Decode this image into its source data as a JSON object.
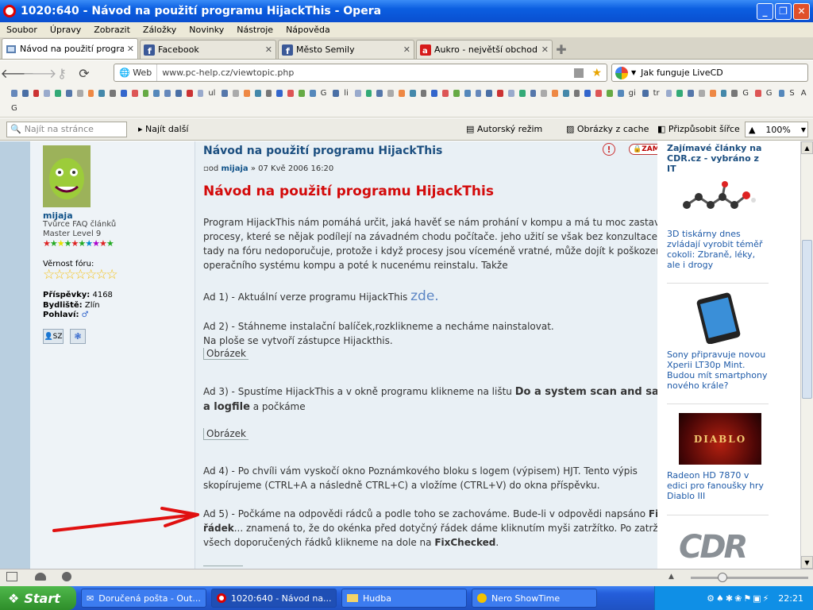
{
  "window": {
    "title": "1020:640 - Návod na použití programu HijackThis - Opera"
  },
  "menu": [
    "Soubor",
    "Úpravy",
    "Zobrazit",
    "Záložky",
    "Novinky",
    "Nástroje",
    "Nápověda"
  ],
  "tabs": [
    {
      "label": "Návod na použití progra...",
      "favicon": "page-icon",
      "active": true
    },
    {
      "label": "Facebook",
      "favicon": "facebook-icon"
    },
    {
      "label": "Město Semily",
      "favicon": "facebook-icon"
    },
    {
      "label": "Aukro - největší obchodn...",
      "favicon": "aukro-icon"
    }
  ],
  "address": {
    "web_label": "Web",
    "url": "www.pc-help.cz/viewtopic.php"
  },
  "search": {
    "query": "Jak funguje LiveCD"
  },
  "bookmark_letters_row1": [
    "ul",
    "G",
    "li",
    "gi",
    "tr",
    "G",
    "G",
    "S",
    "A"
  ],
  "bookmark_letters_row2": [
    "G"
  ],
  "findbar": {
    "find_placeholder": "Najít na stránce",
    "find_next": "Najít další",
    "author_mode": "Autorský režim",
    "images_cache": "Obrázky z cache",
    "fit_width": "Přizpůsobit šířce",
    "zoom": "100%"
  },
  "user": {
    "name": "mijaja",
    "rank": "Tvůrce FAQ článků",
    "level": "Master Level 9",
    "loyalty_label": "Věrnost fóru:",
    "posts_label": "Příspěvky:",
    "posts": "4168",
    "location_label": "Bydliště:",
    "location": "Zlín",
    "gender_label": "Pohlaví:",
    "pm_label": "SZ"
  },
  "post": {
    "title": "Návod na použití programu HijackThis",
    "locked_badge": "ZAMČENO",
    "meta_prefix": "od",
    "author": "mijaja",
    "date": "» 07 Kvě 2006 16:20",
    "heading": "Návod na použití programu HijackThis",
    "intro": "Program HijackThis nám pomáhá určit, jaká havěť se nám prohání v kompu a má tu moc zastavit procesy, které se nějak podílejí na závadném chodu počítače. jeho užití se však bez konzultace tady na fóru nedoporučuje, protože i když procesy jsou víceméně vratné, může dojít k poškození operačního systému kompu a poté k nucenému reinstalu. Takže",
    "ad1": "Ad 1) - Aktuální verze programu HijackThis",
    "ad1_link": "zde.",
    "ad2_line1": "Ad 2) - Stáhneme instalační balíček,rozklikneme a necháme nainstalovat.",
    "ad2_line2": "Na ploše se vytvoří zástupce Hijackthis.",
    "image_label": "Obrázek",
    "ad3_prefix": "Ad 3) - Spustíme HijackThis a v okně programu klikneme na lištu",
    "ad3_bold": "Do a system scan and save a logfile",
    "ad3_suffix": "a počkáme",
    "ad4": "Ad 4) - Po chvíli vám vyskočí okno Poznámkového bloku s logem (výpisem) HJT. Tento výpis skopírujeme (CTRL+A a následně CTRL+C) a vložíme (CTRL+V) do okna příspěvku.",
    "ad5_prefix": "Ad 5) - Počkáme na odpovědi rádců a podle toho se zachováme. Bude-li v odpovědi napsáno",
    "ad5_bold": "Fixni řádek",
    "ad5_middle": "... znamená to, že do okénka před dotyčný řádek dáme kliknutím myši zatržítko. Po zatržení všech doporučených řádků klikneme na dole na",
    "ad5_bold2": "FixChecked",
    "ad5_end": "."
  },
  "sidebar": {
    "header": "Zajímavé články na CDR.cz - vybráno z IT",
    "items": [
      {
        "text": "3D tiskárny dnes zvládají vyrobit téměř cokoli: Zbraně, léky, ale i drogy"
      },
      {
        "text": "Sony připravuje novou Xperii LT30p Mint. Budou mít smartphony nového krále?"
      },
      {
        "text": "Radeon HD 7870 v edici pro fanoušky hry Diablo III"
      }
    ],
    "diablo_logo_text": "DIABLO"
  },
  "taskbar": {
    "start": "Start",
    "tasks": [
      {
        "label": "Doručená pošta - Out..."
      },
      {
        "label": "1020:640 - Návod na...",
        "active": true
      },
      {
        "label": "Hudba"
      },
      {
        "label": "Nero ShowTime"
      }
    ],
    "clock": "22:21"
  },
  "colors": {
    "annotation_arrow": "#e01010",
    "title_bar": "#0b5ee0",
    "heading_red": "#d30a0a"
  }
}
